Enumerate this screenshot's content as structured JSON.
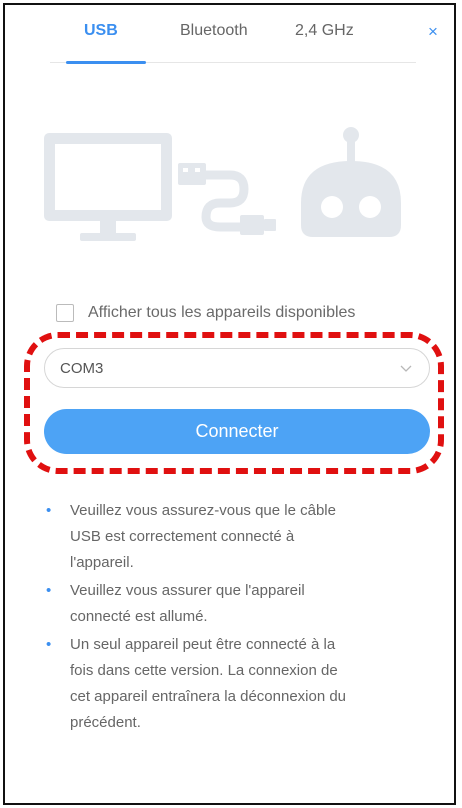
{
  "tabs": {
    "usb": "USB",
    "bluetooth": "Bluetooth",
    "ghz": "2,4 GHz",
    "close": "×"
  },
  "colors": {
    "accent": "#3b8ff0",
    "button": "#4da3f5",
    "highlight_dash": "#e01010",
    "illustration": "#e3e7ec"
  },
  "illustration": {
    "icons": [
      "monitor-icon",
      "usb-cable-icon",
      "robot-icon"
    ]
  },
  "checkbox": {
    "label": "Afficher tous les appareils disponibles",
    "checked": false
  },
  "port_select": {
    "value": "COM3"
  },
  "connect_button": {
    "label": "Connecter"
  },
  "notes": [
    {
      "lines": [
        "Veuillez vous assurez-vous que le câble",
        "USB est correctement connecté à",
        "l'appareil."
      ]
    },
    {
      "lines": [
        "Veuillez vous assurer que l'appareil",
        "connecté est allumé."
      ]
    },
    {
      "lines": [
        "Un seul appareil peut être connecté à la",
        "fois dans cette version. La connexion de",
        "cet appareil entraînera la déconnexion du",
        "précédent."
      ]
    }
  ]
}
